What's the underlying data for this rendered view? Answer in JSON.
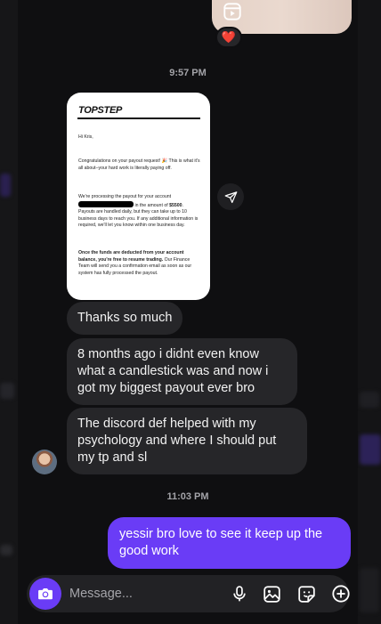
{
  "thread": {
    "reaction_emoji": "❤️",
    "timestamp_1": "9:57 PM",
    "timestamp_2": "11:03 PM"
  },
  "email_screenshot": {
    "logo": "TOPSTEP",
    "greeting": "Hi Kris,",
    "para1": "Congratulations on your payout request! 🎉 This is what it's all about–your hard work is literally paying off.",
    "para2_a": "We're processing the payout for your account",
    "para2_b": "in the amount of",
    "para2_amount": "$5500",
    "para2_c": ". Payouts are handled daily, but they can take up to 10 business days to reach you. If any additional information is required, we'll let you know within one business day.",
    "para3_bold": "Once the funds are deducted from your account balance, you're free to resume trading.",
    "para3_rest": " Our Finance Team will send you a confirmation email as soon as our system has fully processed the payout."
  },
  "messages_in": [
    "Thanks so much",
    "8 months ago i didnt even know what a candlestick was and now i got my biggest payout ever bro",
    "The discord def helped with my psychology and where I should put my tp and sl"
  ],
  "messages_out": [
    "yessir bro love to see it keep up the good work"
  ],
  "composer": {
    "placeholder": "Message..."
  },
  "icons": [
    "reel-icon",
    "heart-reaction",
    "share-icon",
    "camera-icon",
    "microphone-icon",
    "gallery-icon",
    "sticker-icon",
    "plus-icon"
  ],
  "colors": {
    "accent": "#6a3cf6",
    "bubble_in": "#262629",
    "background": "#0f0f11"
  }
}
